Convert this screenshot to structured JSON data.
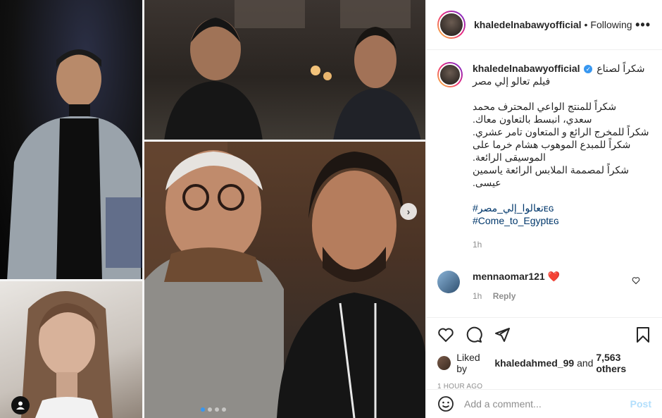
{
  "post": {
    "username": "khaledelnabawyofficial",
    "follow_status": "Following",
    "dot_separator": "•",
    "more_icon": "more-horizontal-icon",
    "caption": {
      "username": "khaledelnabawyofficial",
      "lines_intro": [
        "شكراً لصناع",
        "فيلم تعالو إلي مصر"
      ],
      "paragraph": [
        "شكراً للمنتج الواعي المحترف محمد",
        "سعدي، انبسط بالتعاون معاك.",
        "شكراً للمخرج الرائع و المتعاون تامر عشري.",
        "شكراً للمبدع الموهوب هشام خرما على",
        "الموسيقى الرائعة.",
        "شكراً لمصممة الملابس الرائعة ياسمين",
        "عيسى."
      ],
      "hashtags": [
        "#تعالوا_إلي_مصرᴇɢ",
        "#Come_to_Egyptᴇɢ"
      ],
      "time": "1h"
    },
    "comment": {
      "username": "mennaomar121",
      "emoji": "❤️",
      "time": "1h",
      "reply_label": "Reply"
    },
    "likes": {
      "prefix": "Liked by",
      "user": "khaledahmed_99",
      "and": "and",
      "count": "7,563 others"
    },
    "timestamp": "1 HOUR AGO",
    "add_comment": {
      "placeholder": "Add a comment...",
      "post_label": "Post"
    }
  },
  "carousel": {
    "slide_count": 4,
    "active_slide": 0,
    "next_icon": "chevron-right-icon"
  },
  "colors": {
    "accent": "#3897f0",
    "hashtag": "#00376b",
    "muted": "#8e8e8e",
    "heart": "#ed4956",
    "post_disabled": "#b2dffc"
  }
}
